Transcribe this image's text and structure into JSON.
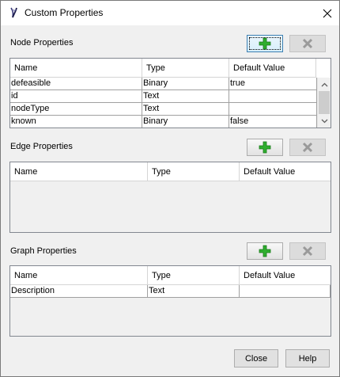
{
  "window": {
    "title": "Custom Properties",
    "close_glyph": "✕"
  },
  "node": {
    "label": "Node Properties",
    "columns": [
      "Name",
      "Type",
      "Default Value"
    ],
    "rows": [
      [
        "defeasible",
        "Binary",
        "true"
      ],
      [
        "id",
        "Text",
        ""
      ],
      [
        "nodeType",
        "Text",
        ""
      ],
      [
        "known",
        "Binary",
        "false"
      ]
    ]
  },
  "edge": {
    "label": "Edge Properties",
    "columns": [
      "Name",
      "Type",
      "Default Value"
    ],
    "rows": []
  },
  "graph": {
    "label": "Graph Properties",
    "columns": [
      "Name",
      "Type",
      "Default Value"
    ],
    "rows": [
      [
        "Description",
        "Text",
        ""
      ]
    ]
  },
  "footer": {
    "close_label": "Close",
    "help_label": "Help"
  },
  "icons": {
    "add": "plus-icon",
    "delete": "x-icon",
    "add_color": "#2fae2f",
    "delete_color": "#9a9a9a"
  }
}
